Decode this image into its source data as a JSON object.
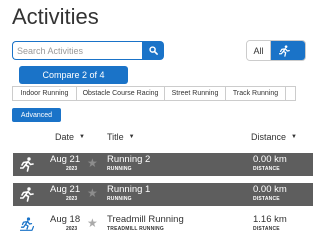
{
  "page": {
    "title": "Activities"
  },
  "search": {
    "placeholder": "Search Activities"
  },
  "filter": {
    "all_label": "All"
  },
  "compare": {
    "label": "Compare 2 of 4"
  },
  "activity_types": [
    "Indoor Running",
    "Obstacle Course Racing",
    "Street Running",
    "Track Running"
  ],
  "advanced": {
    "label": "Advanced"
  },
  "columns": {
    "date": "Date",
    "title": "Title",
    "distance": "Distance"
  },
  "activities": [
    {
      "type_icon": "running-icon",
      "date": "Aug 21",
      "year": "2023",
      "title": "Running 2",
      "subtitle": "RUNNING",
      "distance": "0.00 km",
      "distance_label": "DISTANCE",
      "selected": true
    },
    {
      "type_icon": "running-icon",
      "date": "Aug 21",
      "year": "2023",
      "title": "Running 1",
      "subtitle": "RUNNING",
      "distance": "0.00 km",
      "distance_label": "DISTANCE",
      "selected": true
    },
    {
      "type_icon": "treadmill-icon",
      "date": "Aug 18",
      "year": "2023",
      "title": "Treadmill Running",
      "subtitle": "TREADMILL RUNNING",
      "distance": "1.16 km",
      "distance_label": "DISTANCE",
      "selected": false
    }
  ],
  "colors": {
    "accent": "#1a73c8",
    "selected_row": "#5e5e5e"
  }
}
